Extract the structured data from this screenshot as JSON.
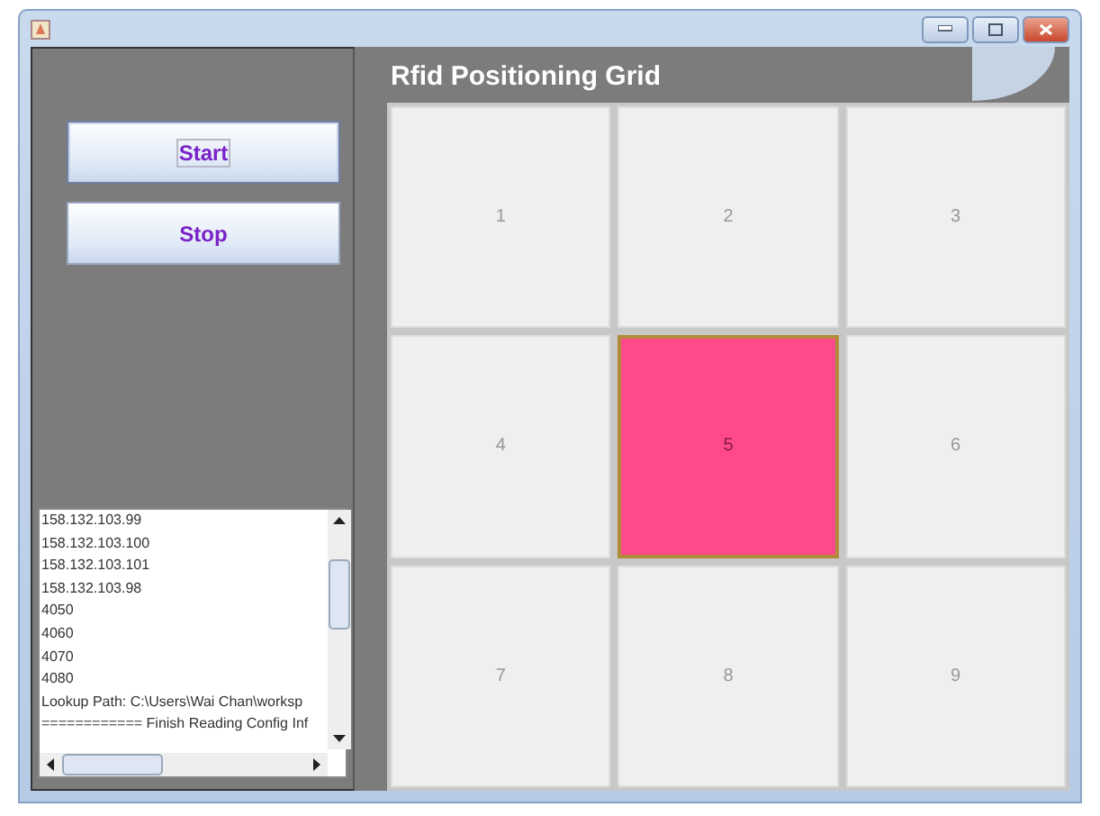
{
  "window": {
    "title": "Rfid Positioning Grid"
  },
  "buttons": [
    {
      "label": "Start",
      "focused": true
    },
    {
      "label": "Stop",
      "focused": false
    }
  ],
  "log": [
    "158.132.103.99",
    "158.132.103.100",
    "158.132.103.101",
    "158.132.103.98",
    "4050",
    "4060",
    "4070",
    "4080",
    "Lookup Path: C:\\Users\\Wai Chan\\worksp",
    "============ Finish Reading Config Inf"
  ],
  "grid": [
    {
      "label": "1",
      "selected": false
    },
    {
      "label": "2",
      "selected": false
    },
    {
      "label": "3",
      "selected": false
    },
    {
      "label": "4",
      "selected": false
    },
    {
      "label": "5",
      "selected": true
    },
    {
      "label": "6",
      "selected": false
    },
    {
      "label": "7",
      "selected": false
    },
    {
      "label": "8",
      "selected": false
    },
    {
      "label": "9",
      "selected": false
    }
  ]
}
